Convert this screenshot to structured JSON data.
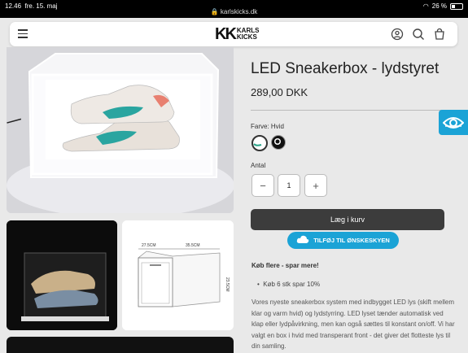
{
  "statusbar": {
    "time": "12.46",
    "date": "fre. 15. maj",
    "url": "karlskicks.dk",
    "battery": "26 %"
  },
  "header": {
    "logo_mark": "KK",
    "logo_line1": "KARLS",
    "logo_line2": "KICKS"
  },
  "product": {
    "title": "LED Sneakerbox - lydstyret",
    "price": "289,00 DKK",
    "color_label": "Farve: Hvid",
    "quantity_label": "Antal",
    "quantity": "1",
    "minus": "−",
    "plus": "+",
    "add_to_cart": "Læg i kurv",
    "wishlist": "TILFØJ TIL ØNSKESKYEN",
    "buy_more": "Køb flere - spar mere!",
    "bullet": "Køb 6 stk spar 10%",
    "description": "Vores nyeste sneakerbox system med indbygget LED lys (skift mellem klar og varm hvid) og lydstyrring. LED lyset tænder automatisk ved klap eller lydpåvirkning, men kan også sættes til konstant on/off. Vi har valgt en box i hvid med transperant front - det giver det flotteste lys til din samling."
  },
  "dimensions": {
    "width": "27.5CM",
    "depth": "35.5CM",
    "height": "23.5CM"
  },
  "colors": {
    "accent": "#1ba3d6",
    "button_dark": "#3c3c3c",
    "swatch_white_ring": "#2aa58a"
  }
}
